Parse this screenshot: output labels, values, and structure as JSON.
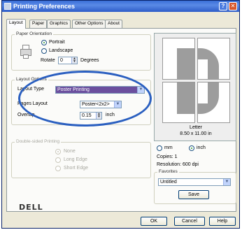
{
  "window": {
    "title": "Printing Preferences",
    "help": "?",
    "close": "✕"
  },
  "tabs": [
    "Layout",
    "Paper",
    "Graphics",
    "Other Options",
    "About"
  ],
  "orientation": {
    "label": "Paper Orientation",
    "portrait": "Portrait",
    "landscape": "Landscape",
    "rotate_label": "Rotate",
    "rotate_value": "0",
    "degrees": "Degrees"
  },
  "layout_options": {
    "label": "Layout Options",
    "layout_type_label": "Layout Type",
    "layout_type_value": "Poster Printing",
    "pages_layout_label": "Pages Layout",
    "pages_layout_value": "Poster<2x2>",
    "overlap_label": "Overlap",
    "overlap_value": "0.15",
    "overlap_unit": "inch"
  },
  "duplex": {
    "label": "Double-sided Printing",
    "none": "None",
    "long_edge": "Long Edge",
    "short_edge": "Short Edge"
  },
  "preview": {
    "paper": "Letter",
    "size": "8.50 x 11.00 in",
    "unit_mm": "mm",
    "unit_inch": "inch",
    "copies": "Copies: 1",
    "resolution": "Resolution: 600 dpi"
  },
  "favorites": {
    "label": "Favorites",
    "value": "Untitled",
    "save": "Save"
  },
  "brand": "DELL",
  "buttons": {
    "ok": "OK",
    "cancel": "Cancel",
    "help": "Help"
  }
}
